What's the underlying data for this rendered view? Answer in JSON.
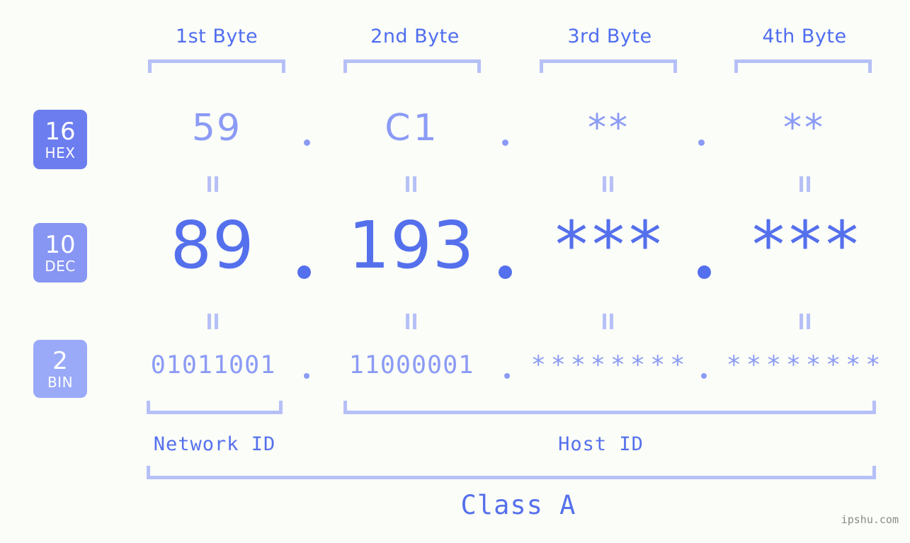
{
  "meta": {
    "background_color": "#fbfdf8",
    "accent_color": "#5570ec",
    "accent_light_color": "#8b9bf5",
    "bracket_color": "#b6c0f7",
    "watermark": "ipshu.com"
  },
  "header": {
    "byte_labels": [
      {
        "label": "1st Byte"
      },
      {
        "label": "2nd Byte"
      },
      {
        "label": "3rd Byte"
      },
      {
        "label": "4th Byte"
      }
    ]
  },
  "bases": [
    {
      "key": "hex",
      "number": "16",
      "name": "HEX",
      "color": "#6c7df0"
    },
    {
      "key": "dec",
      "number": "10",
      "name": "DEC",
      "color": "#8795f3"
    },
    {
      "key": "bin",
      "number": "2",
      "name": "BIN",
      "color": "#9aaaf8"
    }
  ],
  "rows": {
    "hex": {
      "base_number": "16",
      "base_name": "HEX",
      "values": [
        "59",
        "C1",
        "**",
        "**"
      ],
      "separator": "."
    },
    "dec": {
      "base_number": "10",
      "base_name": "DEC",
      "values": [
        "89",
        "193",
        "***",
        "***"
      ],
      "separator": "."
    },
    "bin": {
      "base_number": "2",
      "base_name": "BIN",
      "values": [
        "01011001",
        "11000001",
        "********",
        "********"
      ],
      "separator": "."
    }
  },
  "equality_separator": "=",
  "footer": {
    "network_id_label": "Network ID",
    "host_id_label": "Host ID",
    "class_label": "Class A"
  }
}
